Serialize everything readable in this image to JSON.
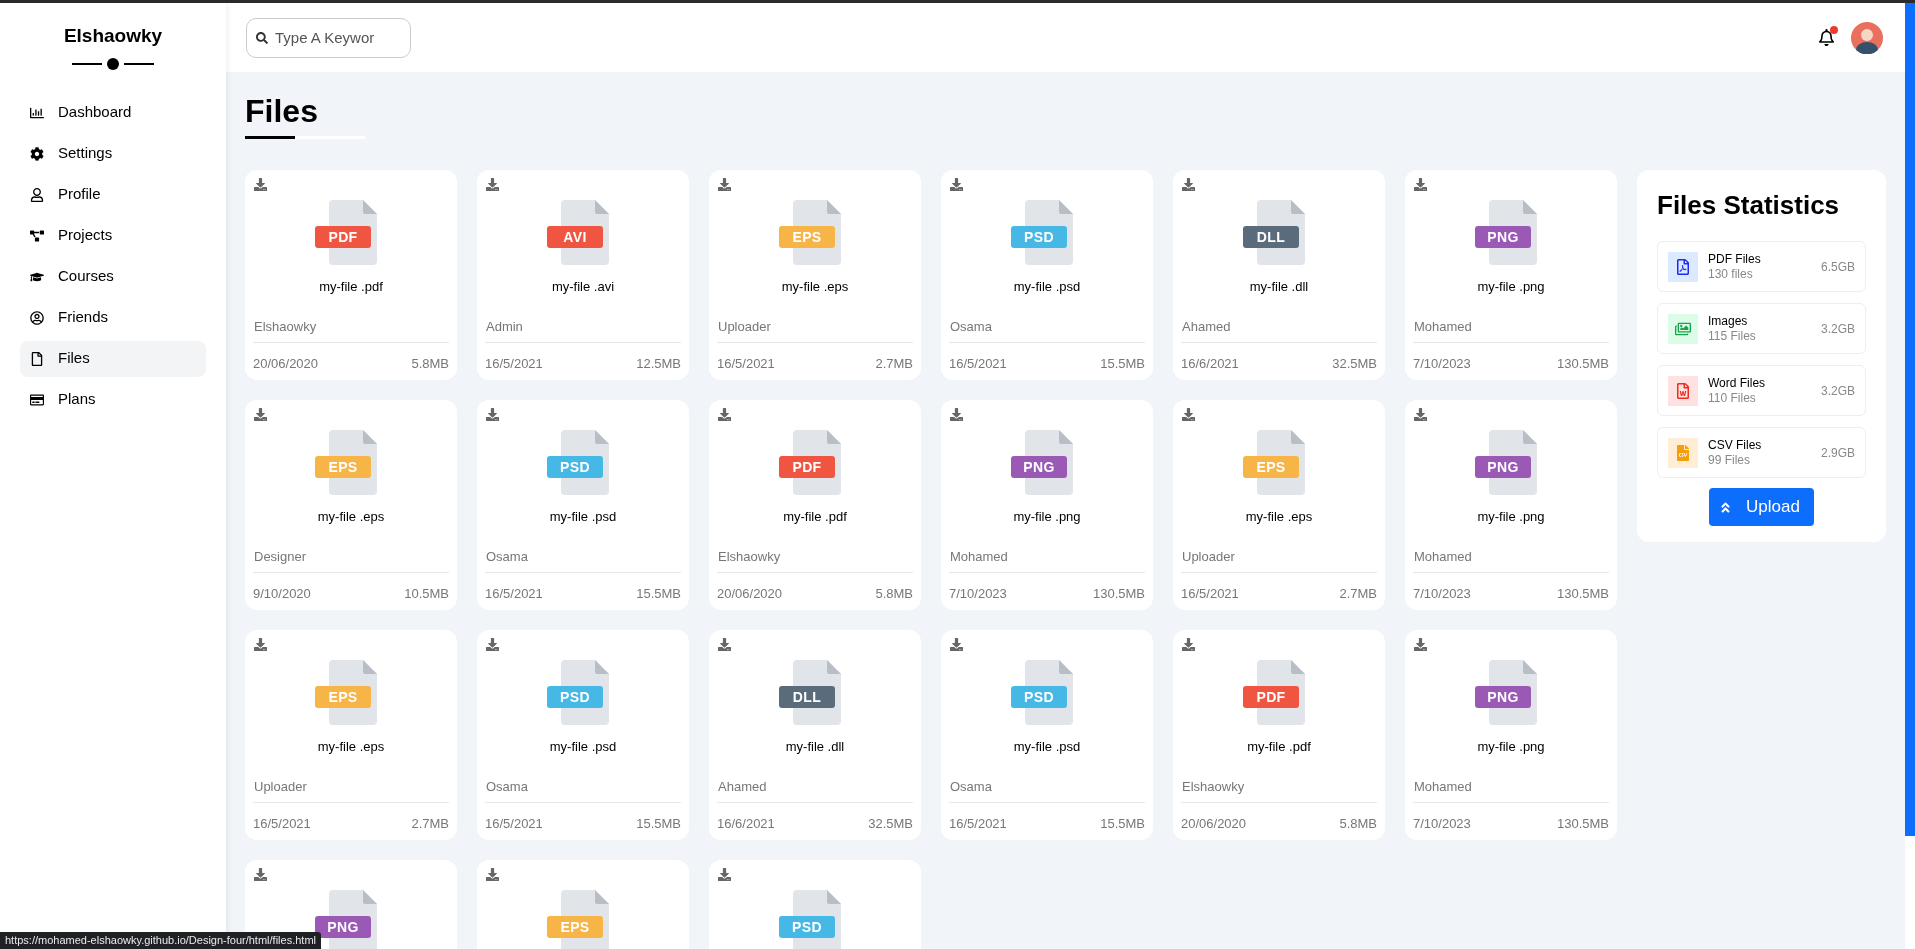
{
  "sidebar": {
    "brand": "Elshaowky",
    "items": [
      {
        "label": "Dashboard",
        "selected": false
      },
      {
        "label": "Settings",
        "selected": false
      },
      {
        "label": "Profile",
        "selected": false
      },
      {
        "label": "Projects",
        "selected": false
      },
      {
        "label": "Courses",
        "selected": false
      },
      {
        "label": "Friends",
        "selected": false
      },
      {
        "label": "Files",
        "selected": true
      },
      {
        "label": "Plans",
        "selected": false
      }
    ]
  },
  "header": {
    "search": {
      "placeholder": "Type A Keywor"
    },
    "notifications": {
      "unread": true
    }
  },
  "page_title": "Files",
  "files": [
    {
      "type": "PDF",
      "color": "#f05542",
      "name": "my-file .pdf",
      "owner": "Elshaowky",
      "date": "20/06/2020",
      "size": "5.8MB"
    },
    {
      "type": "AVI",
      "color": "#f05542",
      "name": "my-file .avi",
      "owner": "Admin",
      "date": "16/5/2021",
      "size": "12.5MB"
    },
    {
      "type": "EPS",
      "color": "#f7b548",
      "name": "my-file .eps",
      "owner": "Uploader",
      "date": "16/5/2021",
      "size": "2.7MB"
    },
    {
      "type": "PSD",
      "color": "#45b8e6",
      "name": "my-file .psd",
      "owner": "Osama",
      "date": "16/5/2021",
      "size": "15.5MB"
    },
    {
      "type": "DLL",
      "color": "#5a6b7c",
      "name": "my-file .dll",
      "owner": "Ahamed",
      "date": "16/6/2021",
      "size": "32.5MB"
    },
    {
      "type": "PNG",
      "color": "#9b59b6",
      "name": "my-file .png",
      "owner": "Mohamed",
      "date": "7/10/2023",
      "size": "130.5MB"
    },
    {
      "type": "EPS",
      "color": "#f7b548",
      "name": "my-file .eps",
      "owner": "Designer",
      "date": "9/10/2020",
      "size": "10.5MB"
    },
    {
      "type": "PSD",
      "color": "#45b8e6",
      "name": "my-file .psd",
      "owner": "Osama",
      "date": "16/5/2021",
      "size": "15.5MB"
    },
    {
      "type": "PDF",
      "color": "#f05542",
      "name": "my-file .pdf",
      "owner": "Elshaowky",
      "date": "20/06/2020",
      "size": "5.8MB"
    },
    {
      "type": "PNG",
      "color": "#9b59b6",
      "name": "my-file .png",
      "owner": "Mohamed",
      "date": "7/10/2023",
      "size": "130.5MB"
    },
    {
      "type": "EPS",
      "color": "#f7b548",
      "name": "my-file .eps",
      "owner": "Uploader",
      "date": "16/5/2021",
      "size": "2.7MB"
    },
    {
      "type": "PNG",
      "color": "#9b59b6",
      "name": "my-file .png",
      "owner": "Mohamed",
      "date": "7/10/2023",
      "size": "130.5MB"
    },
    {
      "type": "EPS",
      "color": "#f7b548",
      "name": "my-file .eps",
      "owner": "Uploader",
      "date": "16/5/2021",
      "size": "2.7MB"
    },
    {
      "type": "PSD",
      "color": "#45b8e6",
      "name": "my-file .psd",
      "owner": "Osama",
      "date": "16/5/2021",
      "size": "15.5MB"
    },
    {
      "type": "DLL",
      "color": "#5a6b7c",
      "name": "my-file .dll",
      "owner": "Ahamed",
      "date": "16/6/2021",
      "size": "32.5MB"
    },
    {
      "type": "PSD",
      "color": "#45b8e6",
      "name": "my-file .psd",
      "owner": "Osama",
      "date": "16/5/2021",
      "size": "15.5MB"
    },
    {
      "type": "PDF",
      "color": "#f05542",
      "name": "my-file .pdf",
      "owner": "Elshaowky",
      "date": "20/06/2020",
      "size": "5.8MB"
    },
    {
      "type": "PNG",
      "color": "#9b59b6",
      "name": "my-file .png",
      "owner": "Mohamed",
      "date": "7/10/2023",
      "size": "130.5MB"
    },
    {
      "type": "PNG",
      "color": "#9b59b6"
    },
    {
      "type": "EPS",
      "color": "#f7b548"
    },
    {
      "type": "PSD",
      "color": "#45b8e6"
    }
  ],
  "statistics": {
    "title": "Files Statistics",
    "items": [
      {
        "kind": "pdf",
        "label": "PDF Files",
        "count": "130 files",
        "size": "6.5GB"
      },
      {
        "kind": "image",
        "label": "Images",
        "count": "115 Files",
        "size": "3.2GB"
      },
      {
        "kind": "word",
        "label": "Word Files",
        "count": "110 Files",
        "size": "3.2GB"
      },
      {
        "kind": "csv",
        "label": "CSV Files",
        "count": "99 Files",
        "size": "2.9GB"
      }
    ],
    "upload_button": "Upload"
  },
  "status_url": "https://mohamed-elshaowky.github.io/Design-four/html/files.html"
}
